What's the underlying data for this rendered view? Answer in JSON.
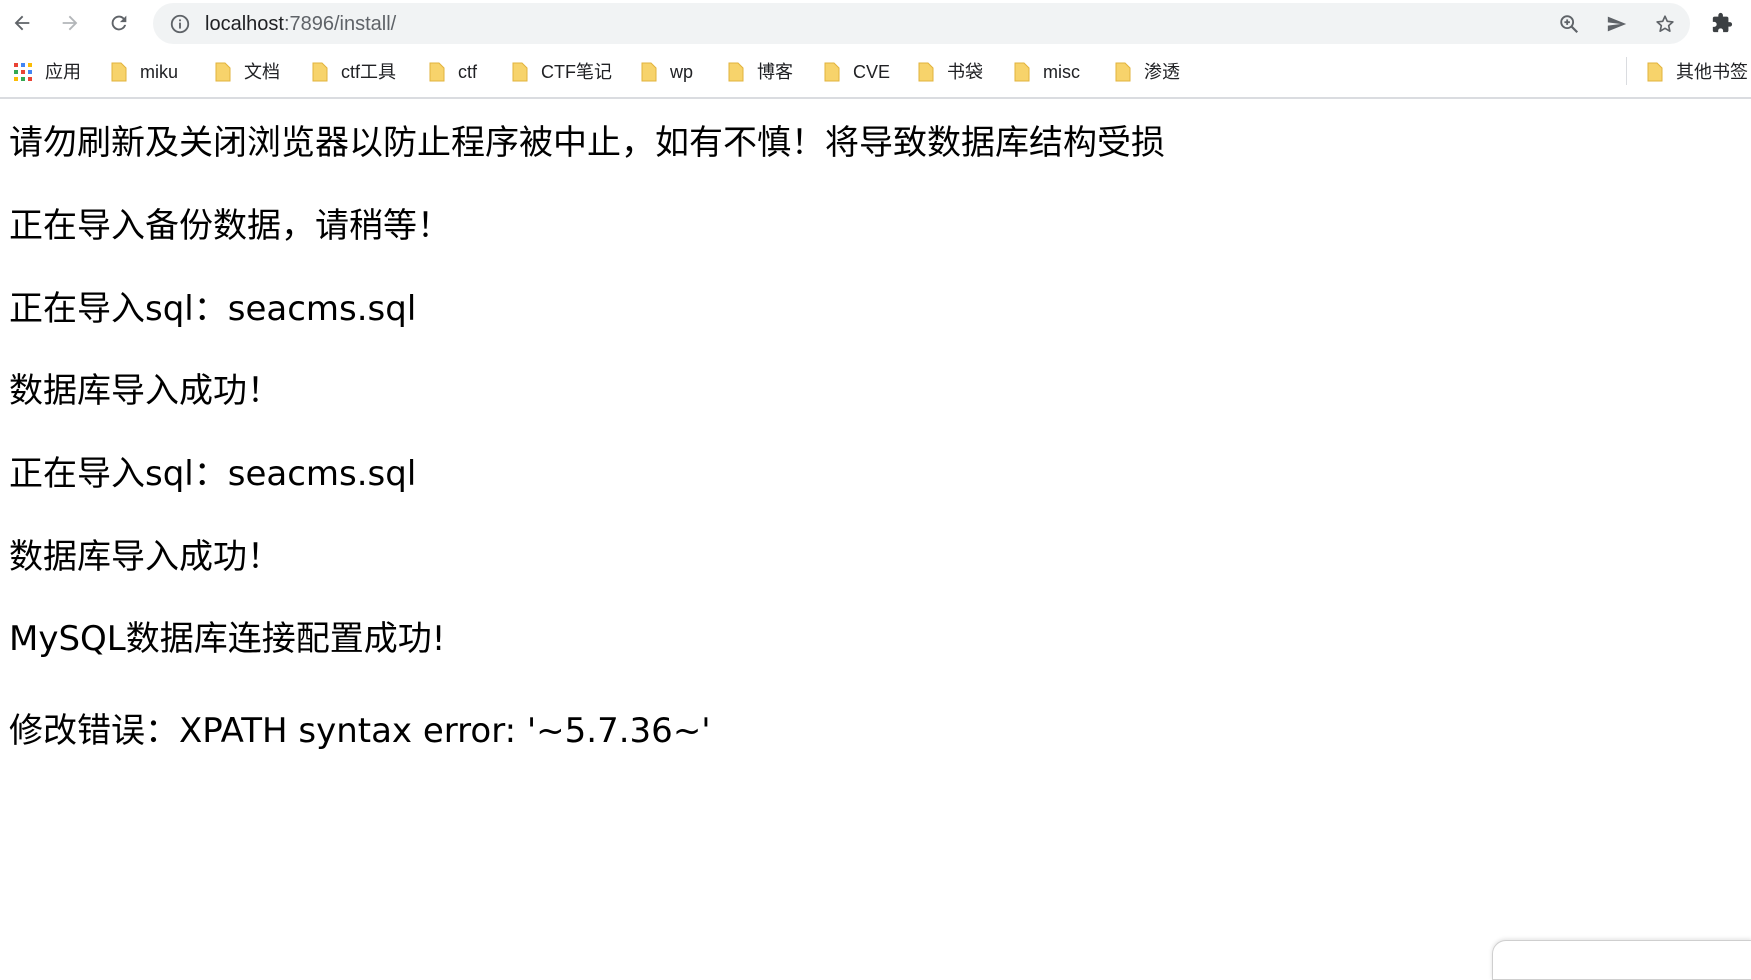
{
  "browser": {
    "url": {
      "host": "localhost",
      "rest": ":7896/install/"
    },
    "bookmarks": [
      {
        "label": "应用",
        "icon": "apps-grid-icon"
      },
      {
        "label": "miku",
        "icon": "folder-icon"
      },
      {
        "label": "文档",
        "icon": "folder-icon"
      },
      {
        "label": "ctf工具",
        "icon": "folder-icon"
      },
      {
        "label": "ctf",
        "icon": "folder-icon"
      },
      {
        "label": "CTF笔记",
        "icon": "folder-icon"
      },
      {
        "label": "wp",
        "icon": "folder-icon"
      },
      {
        "label": "博客",
        "icon": "folder-icon"
      },
      {
        "label": "CVE",
        "icon": "folder-icon"
      },
      {
        "label": "书袋",
        "icon": "folder-icon"
      },
      {
        "label": "misc",
        "icon": "folder-icon"
      },
      {
        "label": "渗透",
        "icon": "folder-icon"
      }
    ],
    "other_bookmarks": {
      "label": "其他书签",
      "icon": "folder-icon"
    },
    "colors": {
      "folder": "#f7d36b",
      "toolbar_icon": "#5f6368",
      "omnibox_bg": "#f1f3f4"
    }
  },
  "page": {
    "lines": [
      "请勿刷新及关闭浏览器以防止程序被中止，如有不慎！将导致数据库结构受损",
      "正在导入备份数据，请稍等！",
      "正在导入sql：seacms.sql",
      "数据库导入成功！",
      "正在导入sql：seacms.sql",
      "数据库导入成功！",
      "MySQL数据库连接配置成功!",
      "修改错误：XPATH syntax error: '~5.7.36~'"
    ]
  }
}
